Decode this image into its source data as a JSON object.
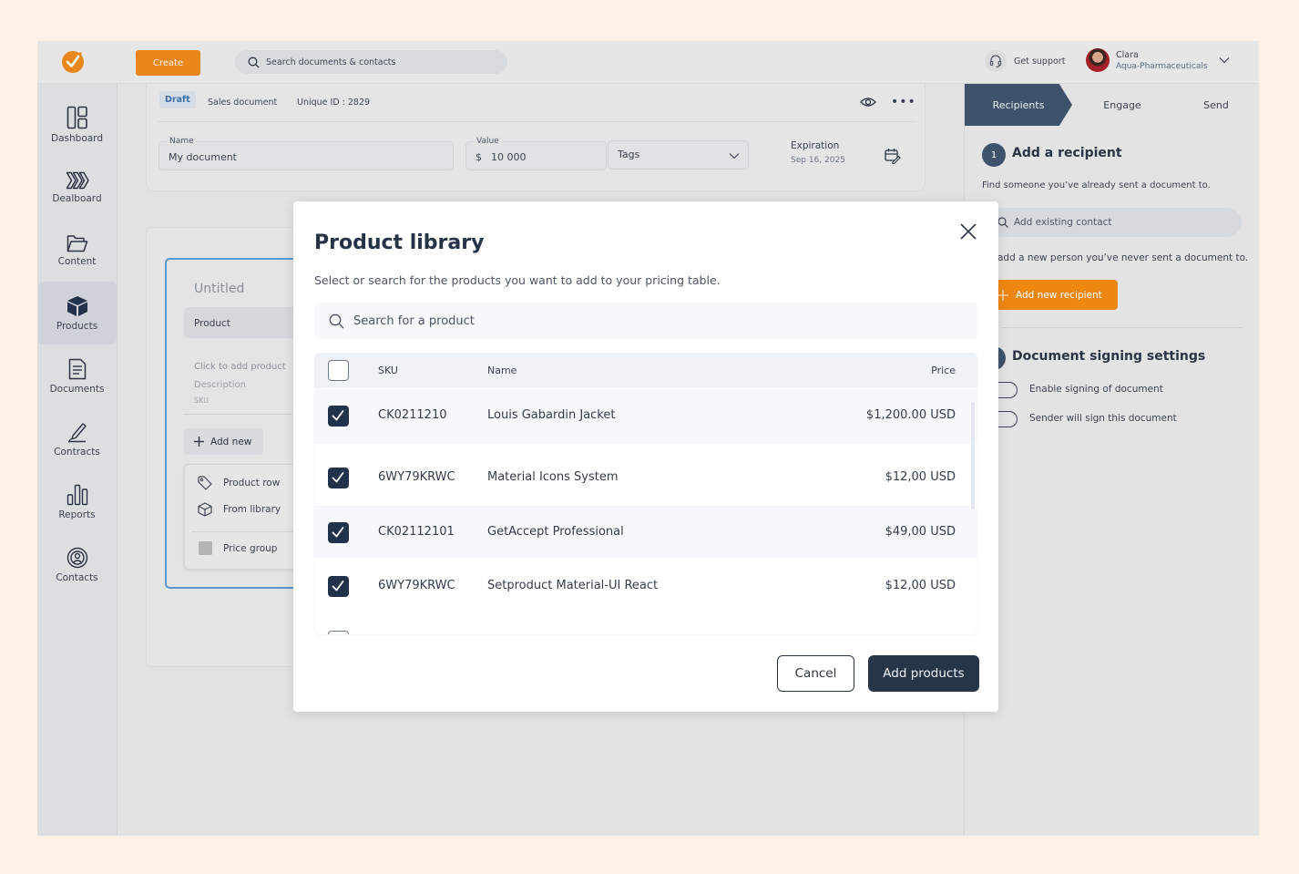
{
  "topbar": {
    "create_label": "Create",
    "search_placeholder": "Search documents & contacts",
    "support_label": "Get support",
    "user_name": "Clara",
    "user_org": "Aqua-Pharmaceuticals"
  },
  "sidebar": {
    "items": [
      {
        "label": "Dashboard",
        "icon": "dashboard-icon"
      },
      {
        "label": "Dealboard",
        "icon": "dealboard-icon"
      },
      {
        "label": "Content",
        "icon": "folder-icon"
      },
      {
        "label": "Products",
        "icon": "box-icon",
        "active": true
      },
      {
        "label": "Documents",
        "icon": "document-icon"
      },
      {
        "label": "Contracts",
        "icon": "pen-icon"
      },
      {
        "label": "Reports",
        "icon": "bar-chart-icon"
      },
      {
        "label": "Contacts",
        "icon": "contacts-icon"
      }
    ]
  },
  "document": {
    "status": "Draft",
    "type": "Sales document",
    "unique_id": "Unique ID : 2829",
    "name_label": "Name",
    "name_value": "My document",
    "value_label": "Value",
    "value_currency": "$",
    "value_amount": "10 000",
    "tags_placeholder": "Tags",
    "expiration_label": "Expiration",
    "expiration_date": "Sep 16, 2025"
  },
  "pricing_table": {
    "title": "Untitled",
    "header": "Product",
    "click_to_add": "Click to add product",
    "description": "Description",
    "sku": "SKU",
    "add_new": "Add new",
    "menu": [
      "Product row",
      "From library",
      "Price group"
    ]
  },
  "right_panel": {
    "steps": [
      "Recipients",
      "Engage",
      "Send"
    ],
    "active_step": "Recipients",
    "step_number": "1",
    "add_recipient_title": "Add a recipient",
    "find_text": "Find someone you’ve already sent a document to.",
    "contact_search_placeholder": "Add existing contact",
    "new_person_text": "add a new person you’ve never sent a document to.",
    "add_new_recipient": "Add new recipient",
    "signing_title": "Document signing settings",
    "toggles": [
      {
        "label": "Enable signing of document",
        "on": false
      },
      {
        "label": "Sender will sign this document",
        "on": false
      }
    ]
  },
  "modal": {
    "title": "Product library",
    "subtitle": "Select or search for the products you want to add to your pricing table.",
    "search_placeholder": "Search for a product",
    "columns": {
      "sku": "SKU",
      "name": "Name",
      "price": "Price"
    },
    "rows": [
      {
        "sku": "CK0211210",
        "name": "Louis Gabardin Jacket",
        "price": "$1,200.00 USD",
        "checked": true
      },
      {
        "sku": "6WY79KRWC",
        "name": "Material Icons System",
        "price": "$12,00 USD",
        "checked": true
      },
      {
        "sku": "CK02112101",
        "name": "GetAccept Professional",
        "price": "$49,00 USD",
        "checked": true
      },
      {
        "sku": "6WY79KRWC",
        "name": "Setproduct Material-UI React",
        "price": "$12,00 USD",
        "checked": true
      }
    ],
    "cancel_label": "Cancel",
    "add_label": "Add products"
  },
  "colors": {
    "brand_orange": "#e9871c",
    "navy": "#273549",
    "step_active": "#3e536b",
    "draft_badge": "#3b6fa8",
    "table_border": "#5b97cf"
  }
}
